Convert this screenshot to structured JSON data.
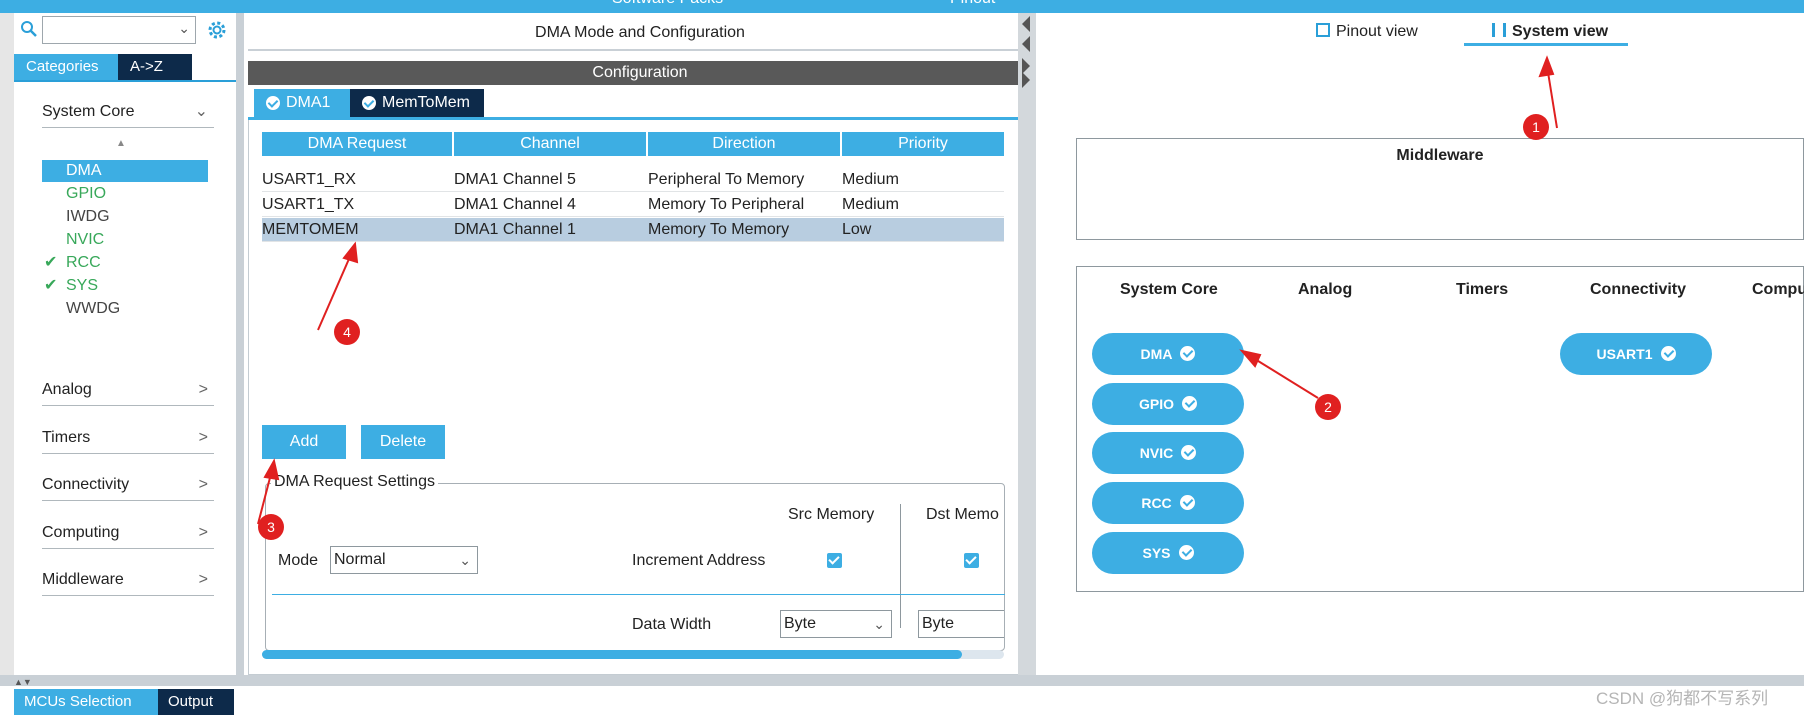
{
  "top_strip": {
    "text_left": "Software Packs",
    "text_right": "Pinout"
  },
  "sidebar": {
    "search_placeholder": "",
    "tabs": [
      "Categories",
      "A->Z"
    ],
    "system_core": {
      "label": "System Core",
      "items": [
        {
          "label": "DMA",
          "selected": true,
          "checked": false
        },
        {
          "label": "GPIO",
          "checked": false
        },
        {
          "label": "IWDG",
          "checked": false
        },
        {
          "label": "NVIC",
          "checked": false
        },
        {
          "label": "RCC",
          "checked": true
        },
        {
          "label": "SYS",
          "checked": true
        },
        {
          "label": "WWDG",
          "checked": false
        }
      ]
    },
    "sections": [
      "Analog",
      "Timers",
      "Connectivity",
      "Computing",
      "Middleware"
    ]
  },
  "middle": {
    "title": "DMA Mode and Configuration",
    "config_label": "Configuration",
    "tabs": [
      "DMA1",
      "MemToMem"
    ],
    "table": {
      "headers": [
        "DMA Request",
        "Channel",
        "Direction",
        "Priority"
      ],
      "rows": [
        [
          "USART1_RX",
          "DMA1 Channel 5",
          "Peripheral To Memory",
          "Medium"
        ],
        [
          "USART1_TX",
          "DMA1 Channel 4",
          "Memory To Peripheral",
          "Medium"
        ],
        [
          "MEMTOMEM",
          "DMA1 Channel 1",
          "Memory To Memory",
          "Low"
        ]
      ],
      "selected_row": 2
    },
    "add_label": "Add",
    "delete_label": "Delete",
    "settings": {
      "legend": "DMA Request Settings",
      "mode_label": "Mode",
      "mode_value": "Normal",
      "src_memory": "Src Memory",
      "dst_memory": "Dst Memo",
      "increment_address": "Increment Address",
      "data_width": "Data Width",
      "src_width": "Byte",
      "dst_width": "Byte"
    }
  },
  "right": {
    "pinout_view": "Pinout view",
    "system_view": "System view",
    "middleware": "Middleware",
    "columns": [
      "System Core",
      "Analog",
      "Timers",
      "Connectivity",
      "Compu"
    ],
    "system_core_pills": [
      "DMA",
      "GPIO",
      "NVIC",
      "RCC",
      "SYS"
    ],
    "connectivity_pills": [
      "USART1"
    ]
  },
  "bottom": {
    "tabs": [
      "MCUs Selection",
      "Output"
    ],
    "watermark": "CSDN @狗都不写系列"
  },
  "annotations": [
    "1",
    "2",
    "3",
    "4"
  ],
  "colors": {
    "accent": "#3daee3",
    "dark_tab": "#0d2a4a",
    "annotation": "#e02020",
    "check_green": "#38a85a"
  }
}
